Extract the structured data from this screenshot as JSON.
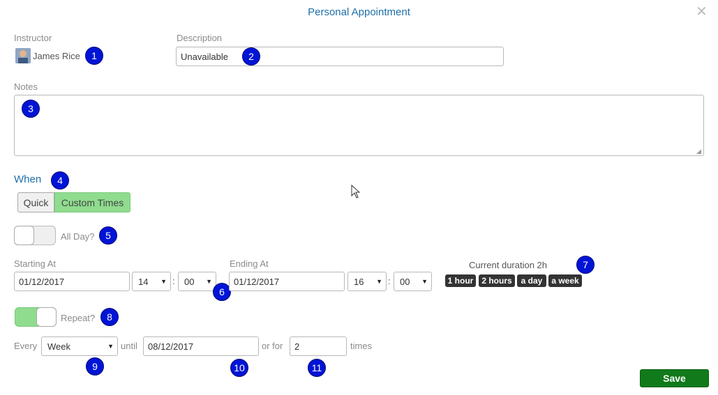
{
  "dialog": {
    "title": "Personal Appointment"
  },
  "instructor": {
    "label": "Instructor",
    "name": "James Rice"
  },
  "description": {
    "label": "Description",
    "value": "Unavailable"
  },
  "notes": {
    "label": "Notes",
    "value": ""
  },
  "when": {
    "label": "When",
    "tabs": [
      {
        "label": "Quick",
        "active": false
      },
      {
        "label": "Custom Times",
        "active": true
      }
    ]
  },
  "all_day": {
    "label": "All Day?",
    "on": false
  },
  "start": {
    "label": "Starting At",
    "date": "01/12/2017",
    "hour": "14",
    "minute": "00"
  },
  "end": {
    "label": "Ending At",
    "date": "01/12/2017",
    "hour": "16",
    "minute": "00"
  },
  "time_separator": ":",
  "duration": {
    "label": "Current duration 2h",
    "presets": [
      "1 hour",
      "2 hours",
      "a day",
      "a week"
    ]
  },
  "repeat": {
    "label": "Repeat?",
    "on": true,
    "every_label": "Every",
    "frequency": "Week",
    "until_label": "until",
    "until_date": "08/12/2017",
    "or_for_label": "or for",
    "times_value": "2",
    "times_label": "times"
  },
  "save_label": "Save",
  "markers": [
    "1",
    "2",
    "3",
    "4",
    "5",
    "6",
    "7",
    "8",
    "9",
    "10",
    "11"
  ],
  "colors": {
    "accent": "#1f6fa9",
    "active_tab": "#8fdc8f",
    "toggle_on": "#8fdc8f",
    "save": "#117a1a",
    "marker": "#0014d6"
  }
}
